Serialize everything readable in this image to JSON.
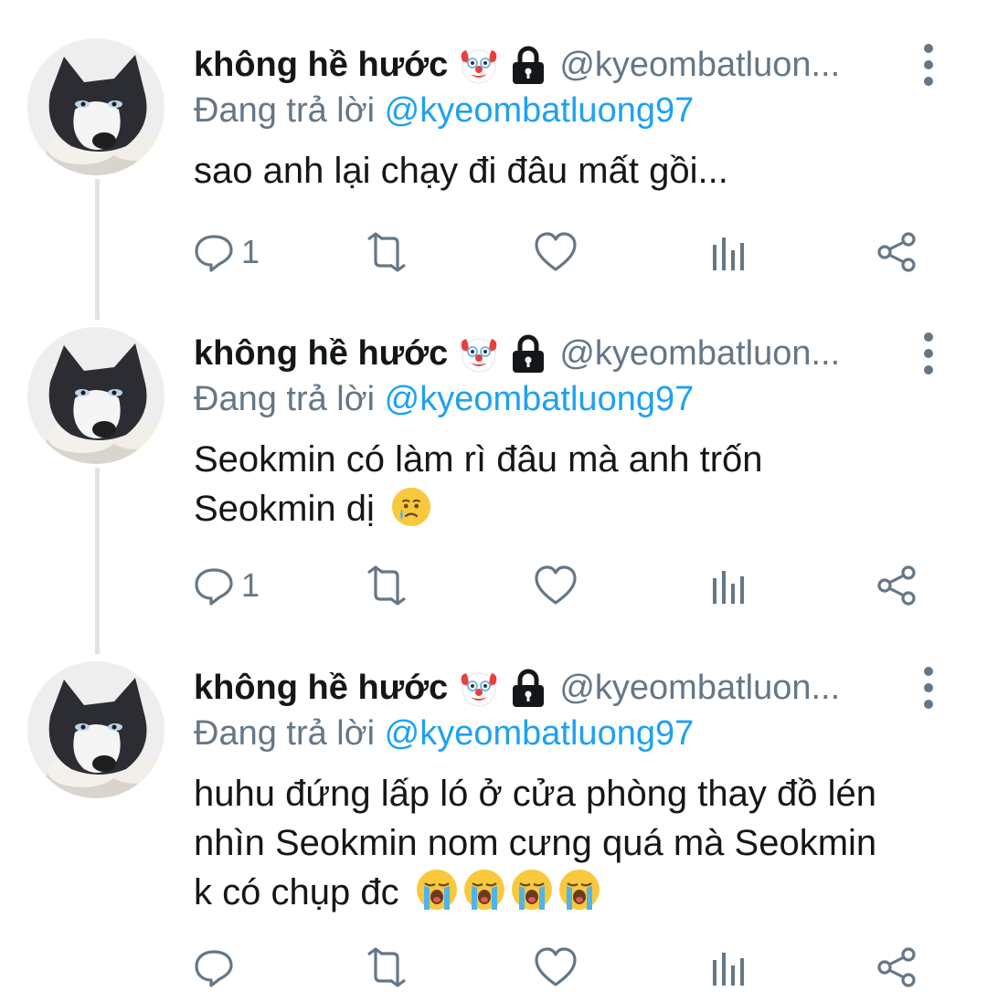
{
  "tweets": [
    {
      "display_name": "không hề hước",
      "handle": "@kyeombatluon...",
      "reply_prefix": "Đang trả lời",
      "reply_mention": "@kyeombatluong97",
      "text": "sao anh lại chạy đi đâu mất gồi...",
      "reply_count": "1",
      "emojis_in_text": []
    },
    {
      "display_name": "không hề hước",
      "handle": "@kyeombatluon...",
      "reply_prefix": "Đang trả lời",
      "reply_mention": "@kyeombatluong97",
      "text_lines": [
        "Seokmin có làm rì đâu mà anh trốn",
        "Seokmin dị"
      ],
      "reply_count": "1",
      "emojis_in_text": [
        "crying-face"
      ]
    },
    {
      "display_name": "không hề hước",
      "handle": "@kyeombatluon...",
      "reply_prefix": "Đang trả lời",
      "reply_mention": "@kyeombatluong97",
      "text_lines": [
        "huhu đứng lấp ló ở cửa phòng thay đồ lén",
        "nhìn Seokmin nom cưng quá mà Seokmin",
        "k có chụp đc"
      ],
      "reply_count": "",
      "emojis_in_text": [
        "loudly-crying-face",
        "loudly-crying-face",
        "loudly-crying-face",
        "loudly-crying-face"
      ]
    }
  ],
  "name_badges": [
    "clown-face-icon",
    "lock-icon"
  ],
  "colors": {
    "name": "#14171a",
    "secondary": "#657786",
    "mention": "#1da1f2",
    "thread_line": "#dfe3e7"
  }
}
